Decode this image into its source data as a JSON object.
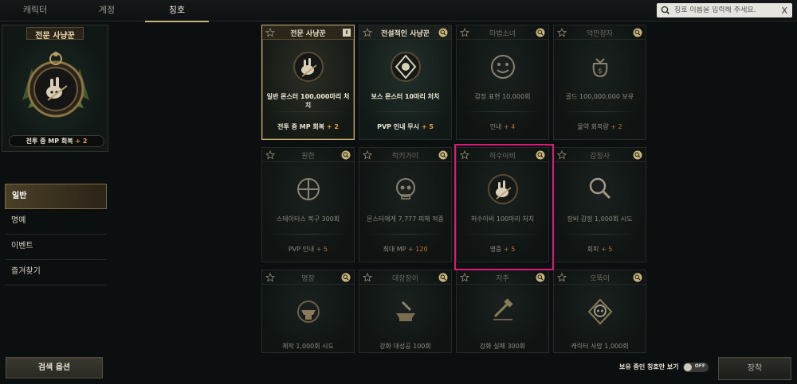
{
  "tabs": [
    {
      "label": "캐릭터"
    },
    {
      "label": "계정"
    },
    {
      "label": "칭호"
    }
  ],
  "search": {
    "placeholder": "칭호 이름을 입력해 주세요.",
    "clear": "X"
  },
  "featured": {
    "title": "전문 사냥꾼",
    "stat": "전투 중 MP 회복",
    "stat_value": "+ 2"
  },
  "menu": [
    {
      "label": "일반"
    },
    {
      "label": "명예"
    },
    {
      "label": "이벤트"
    },
    {
      "label": "즐겨찾기"
    }
  ],
  "search_options_label": "검색 옵션",
  "cards": [
    {
      "name": "전문 사냥꾼",
      "condition": "일반 몬스터 100,000마리 처치",
      "effect": "전투 중 MP 회복",
      "effect_value": "+ 2",
      "icon": "rabbit-skull-icon",
      "badge": "I"
    },
    {
      "name": "전설적인 사냥꾼",
      "condition": "보스 몬스터 10마리 처치",
      "effect": "PVP 인내 무시",
      "effect_value": "+ 5",
      "icon": "crest-icon"
    },
    {
      "name": "마법소녀",
      "condition": "감정 표현 10,000회",
      "effect": "인내",
      "effect_value": "+ 4",
      "icon": "smiley-icon"
    },
    {
      "name": "억만장자",
      "condition": "골드 100,000,000 보유",
      "effect": "물약 회복량",
      "effect_value": "+ 2",
      "icon": "money-bag-icon"
    },
    {
      "name": "원한",
      "condition": "스테이터스 복구 300회",
      "effect": "PVP 인내",
      "effect_value": "+ 5",
      "icon": "crosshair-icon"
    },
    {
      "name": "럭키가이",
      "condition": "몬스터에게 7,777 피해 적중",
      "effect": "최대 MP",
      "effect_value": "+ 120",
      "icon": "skull-icon"
    },
    {
      "name": "허수아비",
      "condition": "허수아비 100마리 처치",
      "effect": "명중",
      "effect_value": "+ 5",
      "icon": "rabbit-skull-icon"
    },
    {
      "name": "감정사",
      "condition": "장비 감정 1,000회 시도",
      "effect": "회피",
      "effect_value": "+ 5",
      "icon": "magnifier-icon"
    },
    {
      "name": "명장",
      "condition": "제작 1,000회 시도",
      "effect": "",
      "effect_value": "",
      "icon": "anvil-icon"
    },
    {
      "name": "대장장이",
      "condition": "강화 대성공 100회",
      "effect": "",
      "effect_value": "",
      "icon": "smithing-icon"
    },
    {
      "name": "저주",
      "condition": "강화 실패 300회",
      "effect": "",
      "effect_value": "",
      "icon": "broken-hammer-icon"
    },
    {
      "name": "오뚝이",
      "condition": "캐릭터 사망 1,000회",
      "effect": "",
      "effect_value": "",
      "icon": "skull-crest-icon"
    }
  ],
  "owned_toggle": {
    "label": "보유 중인 칭호만 보기",
    "state": "OFF"
  },
  "equip_label": "장착",
  "colors": {
    "accent": "#c9b479",
    "plus": "#e79a3a",
    "highlight": "#e0167a"
  }
}
